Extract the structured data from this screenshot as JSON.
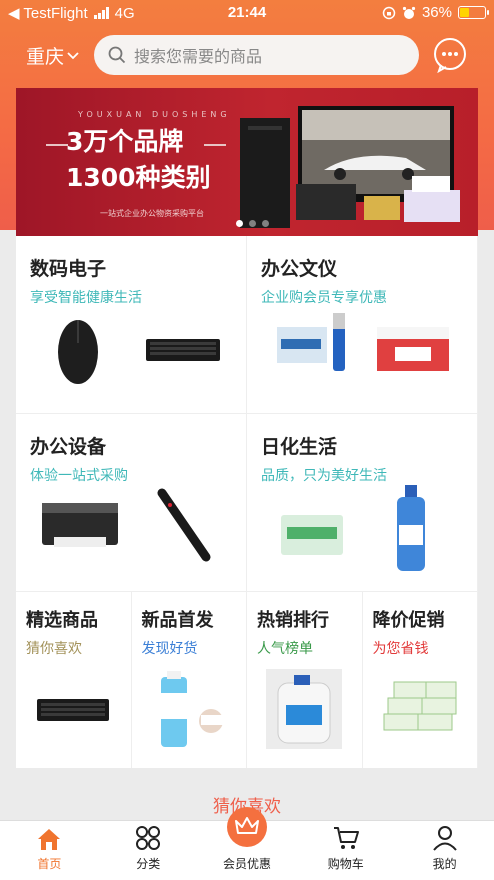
{
  "status_bar": {
    "carrier": "◀ TestFlight",
    "network": "4G",
    "time": "21:44",
    "battery": "36%",
    "battery_level": 0.36
  },
  "header": {
    "city": "重庆",
    "search_placeholder": "搜索您需要的商品",
    "accent_color": "#f37e3f"
  },
  "banner": {
    "english_tagline": "YOUXUAN DUOSHENG",
    "headline_1": "3万个品牌",
    "headline_2": "1300种类别",
    "subline": "一站式企业办公物资采购平台",
    "active_dot": 0,
    "dot_count": 3
  },
  "categories": [
    {
      "title": "数码电子",
      "subtitle": "享受智能健康生活"
    },
    {
      "title": "办公文仪",
      "subtitle": "企业购会员专享优惠"
    },
    {
      "title": "办公设备",
      "subtitle": "体验一站式采购"
    },
    {
      "title": "日化生活",
      "subtitle": "品质，只为美好生活"
    }
  ],
  "promos": [
    {
      "title": "精选商品",
      "subtitle": "猜你喜欢",
      "color": "#a3925a"
    },
    {
      "title": "新品首发",
      "subtitle": "发现好货",
      "color": "#3b7fd6"
    },
    {
      "title": "热销排行",
      "subtitle": "人气榜单",
      "color": "#3a9a4a"
    },
    {
      "title": "降价促销",
      "subtitle": "为您省钱",
      "color": "#e23a3a"
    }
  ],
  "section_title": "猜你喜欢",
  "tabbar": {
    "items": [
      {
        "label": "首页",
        "icon": "home-icon",
        "active": true
      },
      {
        "label": "分类",
        "icon": "category-icon",
        "active": false
      },
      {
        "label": "会员优惠",
        "icon": "crown-icon",
        "active": false
      },
      {
        "label": "购物车",
        "icon": "cart-icon",
        "active": false
      },
      {
        "label": "我的",
        "icon": "user-icon",
        "active": false
      }
    ]
  }
}
